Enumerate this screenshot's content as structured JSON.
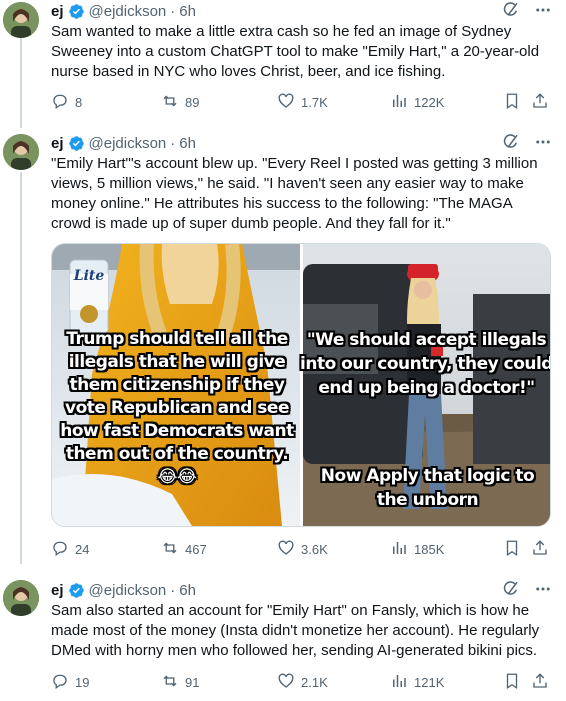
{
  "tweets": [
    {
      "name": "ej",
      "handle": "@ejdickson",
      "time": "6h",
      "text": "Sam wanted to make a little extra cash so he fed an image of Sydney Sweeney into a custom ChatGPT tool to make \"Emily Hart,\" a 20-year-old nurse based in NYC who loves Christ, beer, and ice fishing.",
      "replies": "8",
      "reposts": "89",
      "likes": "1.7K",
      "views": "122K"
    },
    {
      "name": "ej",
      "handle": "@ejdickson",
      "time": "6h",
      "text": "\"Emily Hart\"'s account blew up. \"Every Reel I posted was getting 3 million views, 5 million views,\" he said. \"I haven't seen any easier way to make money online.\" He attributes his success to the following: \"The MAGA crowd is made up of super dumb people. And they fall for it.\"",
      "media": {
        "left_caption": "Trump should tell all the illegals that he will give them citizenship if they vote Republican and see how fast Democrats want them out of the country. 😂😂",
        "right_caption_top": "\"We should accept illegals into our country, they could end up being a doctor!\"",
        "right_caption_bottom": "Now Apply that logic to the unborn",
        "can_label": "Lite"
      },
      "replies": "24",
      "reposts": "467",
      "likes": "3.6K",
      "views": "185K"
    },
    {
      "name": "ej",
      "handle": "@ejdickson",
      "time": "6h",
      "text": "Sam also started an account for \"Emily Hart\" on Fansly, which is how he made most of the money (Insta didn't monetize her account). He regularly DMed with horny men who followed her, sending AI-generated bikini pics.",
      "replies": "19",
      "reposts": "91",
      "likes": "2.1K",
      "views": "121K"
    }
  ],
  "colors": {
    "text": "#0f1419",
    "muted": "#536471",
    "verified": "#1d9bf0",
    "thread": "#cfd9de"
  },
  "icons": [
    "reply-icon",
    "repost-icon",
    "like-icon",
    "views-icon",
    "bookmark-icon",
    "share-icon",
    "grok-icon",
    "more-icon",
    "verified-badge-icon"
  ]
}
